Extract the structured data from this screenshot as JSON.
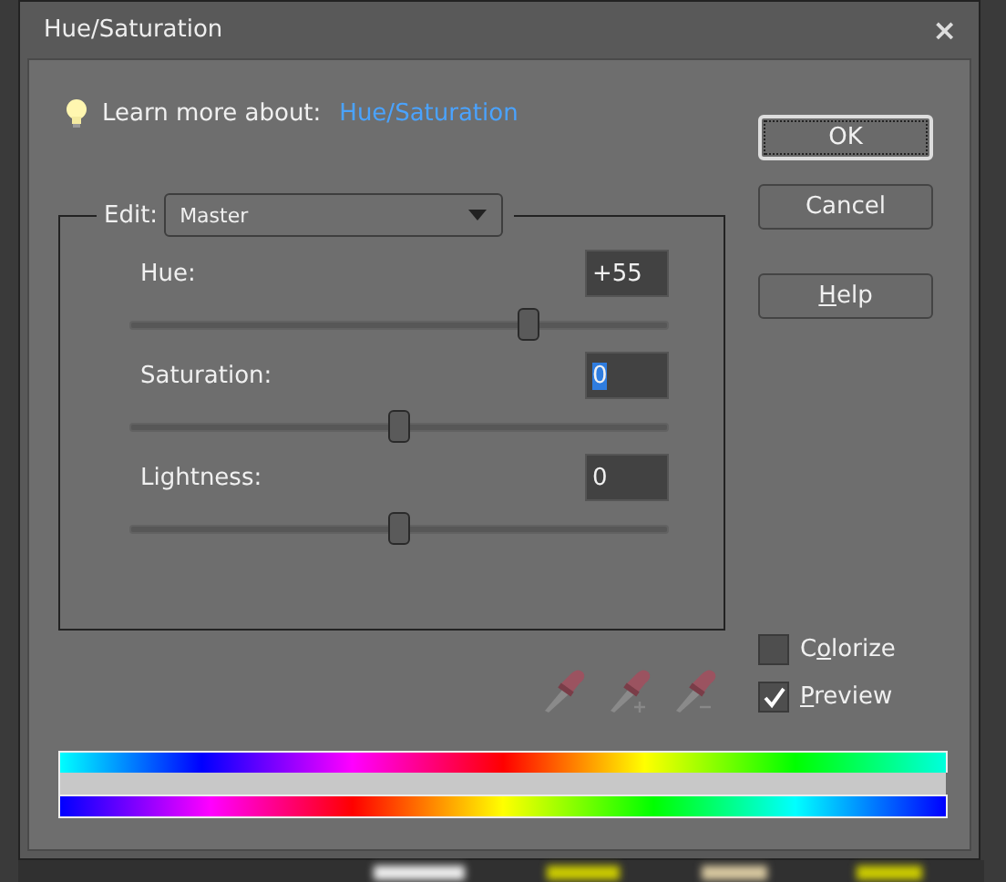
{
  "window": {
    "title": "Hue/Saturation",
    "close": "×"
  },
  "learn_more": {
    "label": "Learn more about:",
    "link": "Hue/Saturation"
  },
  "edit": {
    "label": "Edit:",
    "value": "Master"
  },
  "adjustments": [
    {
      "label": "Hue:",
      "value": "+55",
      "level": 0.74,
      "highlighted": false
    },
    {
      "label": "Saturation:",
      "value": "0",
      "level": 0.5,
      "highlighted": true
    },
    {
      "label": "Lightness:",
      "value": "0",
      "level": 0.5,
      "highlighted": false
    }
  ],
  "buttons": [
    {
      "label": "OK",
      "default": true
    },
    {
      "label": "Cancel",
      "default": false
    },
    {
      "access_key": "H",
      "label_rest": "elp",
      "default": false
    }
  ],
  "options": [
    {
      "label_start": "C",
      "access_key": "o",
      "label_rest": "lorize",
      "checked": false
    },
    {
      "access_key": "P",
      "label_rest": "review",
      "checked": true
    }
  ]
}
